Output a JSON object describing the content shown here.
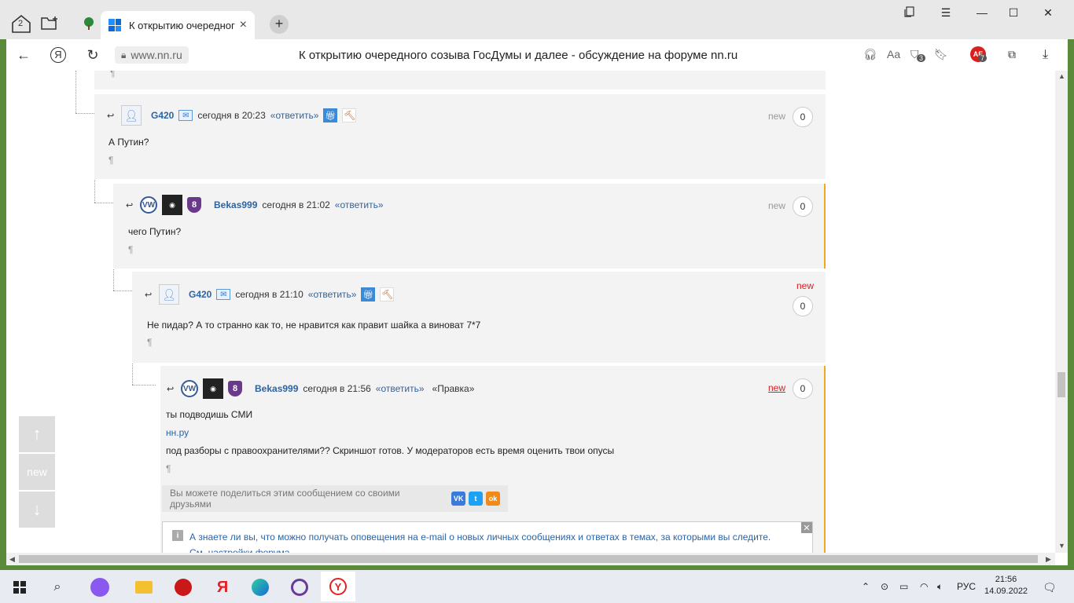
{
  "browser": {
    "tab_count": "2",
    "tab_title": "К открытию очередного созыва ГосДумы и далее - обсуждение на форуме nn.ru",
    "url": "www.nn.ru",
    "page_title": "К открытию очередного созыва ГосДумы и далее - обсуждение на форуме nn.ru",
    "new_tab": "+",
    "badge_downloads": "3",
    "badge_ext": "7",
    "ext_label": "AE"
  },
  "posts": [
    {
      "user": "G420",
      "time": "сегодня в 20:23",
      "reply": "«ответить»",
      "new": "new",
      "count": "0",
      "text": "А Путин?",
      "pilcrow": "¶"
    },
    {
      "user": "Bekas999",
      "time": "сегодня в 21:02",
      "reply": "«ответить»",
      "new": "new",
      "count": "0",
      "text": "чего Путин?",
      "pilcrow": "¶"
    },
    {
      "user": "G420",
      "time": "сегодня в 21:10",
      "reply": "«ответить»",
      "new": "new",
      "count": "0",
      "text": "Не пидар? А то странно как то, не нравится как правит шайка а виноват 7*7",
      "pilcrow": "¶"
    },
    {
      "user": "Bekas999",
      "time": "сегодня в 21:56",
      "reply": "«ответить»",
      "edit": "«Правка»",
      "new": "new",
      "count": "0",
      "line1": "ты подводишь СМИ",
      "link": "нн.ру",
      "line2": "под разборы с правоохранителями?? Скриншот готов. У модераторов есть время оценить твои опусы",
      "pilcrow": "¶"
    }
  ],
  "top_pilcrow": "¶",
  "share": {
    "text": "Вы можете поделиться этим сообщением со своими друзьями",
    "vk": "VK",
    "tw": "t",
    "ok": "ok"
  },
  "tip": {
    "text": "А знаете ли вы, что можно получать оповещения на e-mail о новых личных сообщениях и ответах в темах, за которыми вы следите. См. настройки форума.",
    "close": "✕"
  },
  "side_nav": {
    "up": "↑",
    "new": "new",
    "down": "↓"
  },
  "taskbar": {
    "lang": "РУС",
    "time": "21:56",
    "date": "14.09.2022"
  }
}
